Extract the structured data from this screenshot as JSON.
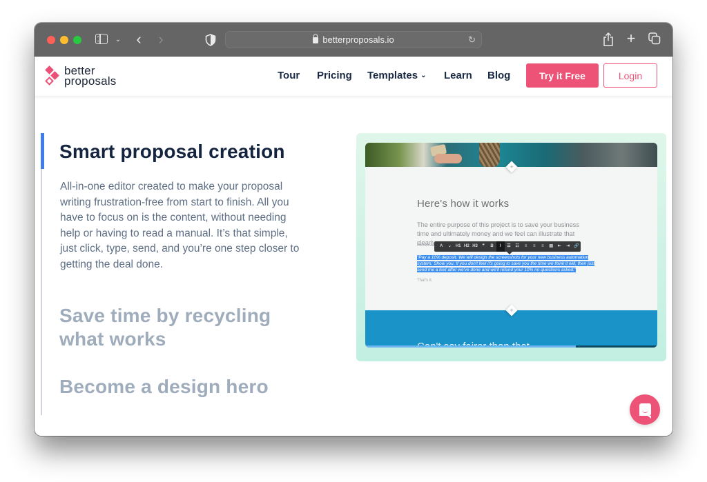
{
  "browser": {
    "url": "betterproposals.io",
    "icons": {
      "close": "traffic-light-red",
      "minimize": "traffic-light-yellow",
      "maximize": "traffic-light-green",
      "sidebar": "sidebar-icon",
      "tab_group_menu": "chevron-down-icon",
      "back": "chevron-left-icon",
      "forward": "chevron-right-icon",
      "privacy": "shield-icon",
      "secure": "lock-icon",
      "reload": "reload-icon",
      "share": "share-icon",
      "new_tab": "plus-icon",
      "tab_overview": "tabs-icon"
    },
    "glyphs": {
      "chevron_down": "⌄",
      "back": "‹",
      "forward": "›",
      "reload": "↻",
      "plus": "+"
    }
  },
  "site": {
    "logo": {
      "line1": "better",
      "line2": "proposals"
    },
    "nav": {
      "items": [
        {
          "label": "Tour"
        },
        {
          "label": "Pricing"
        },
        {
          "label": "Templates",
          "has_dropdown": true
        },
        {
          "label": "Learn"
        },
        {
          "label": "Blog"
        }
      ],
      "dropdown_caret": "⌄",
      "cta_primary": "Try it Free",
      "cta_secondary": "Login"
    },
    "colors": {
      "brand_pink": "#ec5376",
      "heading_dark": "#14243f",
      "active_rail": "#3f7de8",
      "inactive_heading": "#9eacbb"
    }
  },
  "features": {
    "items": [
      {
        "title": "Smart proposal creation",
        "active": true,
        "description": "All-in-one editor created to make your proposal writing frustration-free from start to finish. All you have to focus on is the content, without needing help or having to read a manual. It’s that simple, just click, type, send, and you’re one step closer to getting the deal done."
      },
      {
        "title": "Save time by recycling what works",
        "active": false
      },
      {
        "title": "Become a design hero",
        "active": false
      }
    ]
  },
  "preview": {
    "heading": "Here's how it works",
    "paragraph": "The entire purpose of this project is to save your business time and ultimately money and we feel can illustrate that clearly.",
    "because_text": "Because o",
    "toolbar": [
      "A",
      "⌄",
      "H1",
      "H2",
      "H3",
      "❞",
      "B",
      "I",
      "☰",
      "☷",
      "≡",
      "≡",
      "≡",
      "▤",
      "⇤",
      "⇥",
      "🔗"
    ],
    "toolbar_active_index": 7,
    "selected_text": "\"Pay a 10% deposit. We will design the screenshots for your new business automation system. Show you. If you don't feel it's going to save you the time we think it will, then just send me a text after we've done and we'll refund your 10% no questions asked.\"",
    "closing": "That's it.",
    "blue_section_text": "Can't say fairer than that",
    "progress": 0.72
  },
  "chat": {
    "icon": "chat-bubble-icon"
  }
}
